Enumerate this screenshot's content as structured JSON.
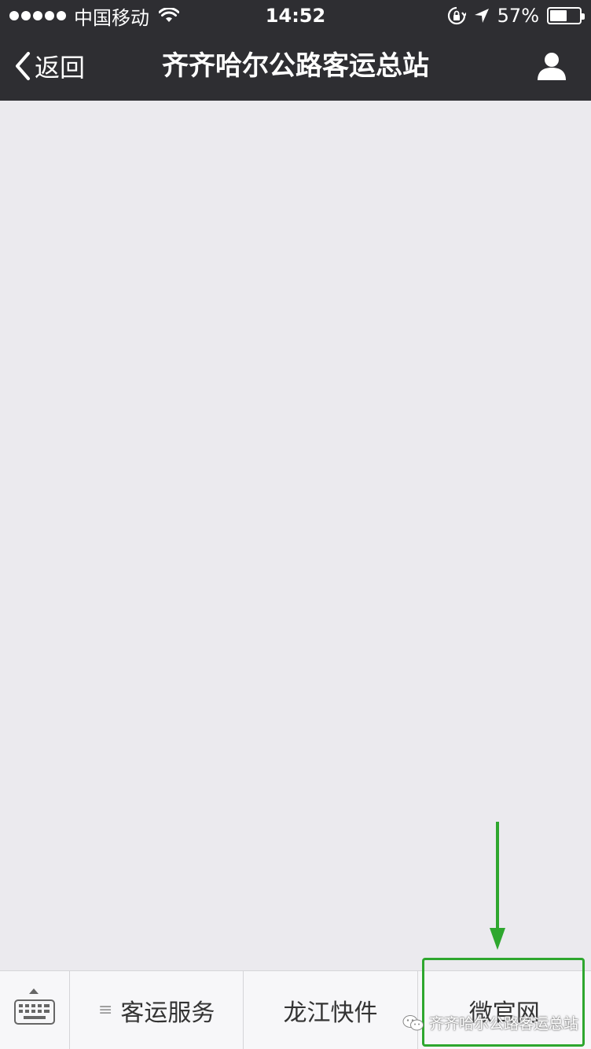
{
  "status_bar": {
    "carrier": "中国移动",
    "time": "14:52",
    "battery_percent": "57%",
    "battery_level": 0.57,
    "icons": [
      "signal-dots-icon",
      "wifi-icon",
      "rotation-lock-icon",
      "location-arrow-icon",
      "battery-icon"
    ]
  },
  "nav_bar": {
    "back_label": "返回",
    "title": "齐齐哈尔公路客运总站",
    "profile_icon": "person-icon"
  },
  "bottom_menu": {
    "keyboard_icon": "keyboard-icon",
    "items": [
      {
        "label": "客运服务",
        "has_submenu": true
      },
      {
        "label": "龙江快件",
        "has_submenu": false
      },
      {
        "label": "微官网",
        "has_submenu": false
      }
    ]
  },
  "annotation": {
    "highlight_color": "#2ea72e",
    "arrow_color": "#2ea72e"
  },
  "watermark": {
    "text": "齐齐哈尔公路客运总站",
    "icon": "wechat-icon"
  },
  "colors": {
    "bar_bg": "#2e2e32",
    "content_bg": "#ebeaee",
    "menu_bg": "#f7f7f9"
  }
}
